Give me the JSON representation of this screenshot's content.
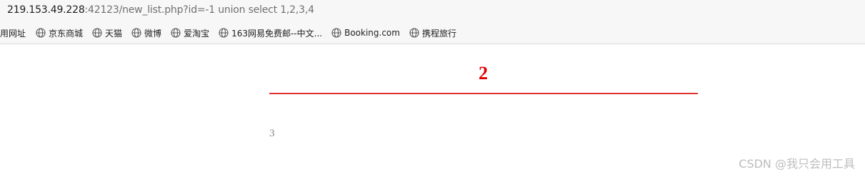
{
  "address_bar": {
    "host": "219.153.49.228",
    "rest": ":42123/new_list.php?id=-1 union select 1,2,3,4"
  },
  "bookmarks": [
    {
      "label": "用网址",
      "icon": "none"
    },
    {
      "label": "京东商城",
      "icon": "globe-icon"
    },
    {
      "label": "天猫",
      "icon": "globe-icon"
    },
    {
      "label": "微博",
      "icon": "globe-icon"
    },
    {
      "label": "爱淘宝",
      "icon": "globe-icon"
    },
    {
      "label": "163网易免费邮--中文...",
      "icon": "globe-icon"
    },
    {
      "label": "Booking.com",
      "icon": "globe-icon"
    },
    {
      "label": "携程旅行",
      "icon": "globe-icon"
    }
  ],
  "page": {
    "title_value": "2",
    "body_value": "3",
    "accent_color": "#e00000"
  },
  "watermark": "CSDN @我只会用工具"
}
